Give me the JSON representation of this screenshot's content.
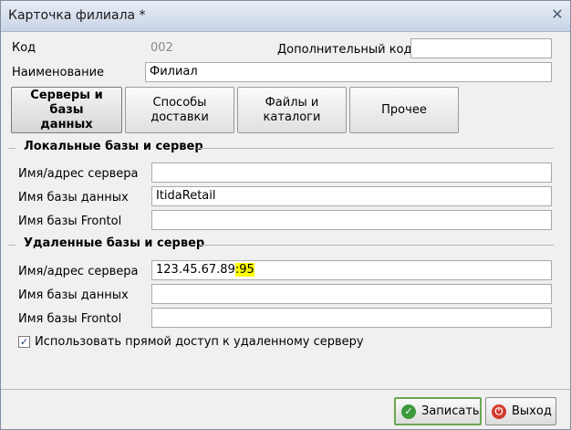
{
  "window": {
    "title": "Карточка филиала *"
  },
  "form": {
    "code_label": "Код",
    "code_value": "002",
    "extra_code_label": "Дополнительный код",
    "extra_code_value": "",
    "name_label": "Наименование",
    "name_value": "Филиал"
  },
  "tabs": [
    {
      "label_line1": "Серверы и базы",
      "label_line2": "данных"
    },
    {
      "label_line1": "Способы",
      "label_line2": "доставки"
    },
    {
      "label_line1": "Файлы и",
      "label_line2": "каталоги"
    },
    {
      "label_line1": "Прочее",
      "label_line2": ""
    }
  ],
  "local": {
    "title": "Локальные базы и сервер",
    "server_label": "Имя/адрес сервера",
    "server_value": "",
    "db_label": "Имя базы данных",
    "db_value": "ItidaRetail",
    "frontol_label": "Имя базы Frontol",
    "frontol_value": ""
  },
  "remote": {
    "title": "Удаленные  базы и сервер",
    "server_label": "Имя/адрес сервера",
    "server_value_main": "123.45.67.89",
    "server_value_port": ":95",
    "db_label": "Имя базы данных",
    "db_value": "",
    "frontol_label": "Имя базы Frontol",
    "frontol_value": ""
  },
  "direct_access": {
    "label": "Использовать прямой доступ к удаленному серверу",
    "checked": true
  },
  "buttons": {
    "save": "Записать",
    "exit": "Выход"
  },
  "colors": {
    "highlight": "#ffff00",
    "save_border": "#6aa84f",
    "exit_icon": "#d23a2a",
    "save_icon": "#3c9a3c"
  }
}
